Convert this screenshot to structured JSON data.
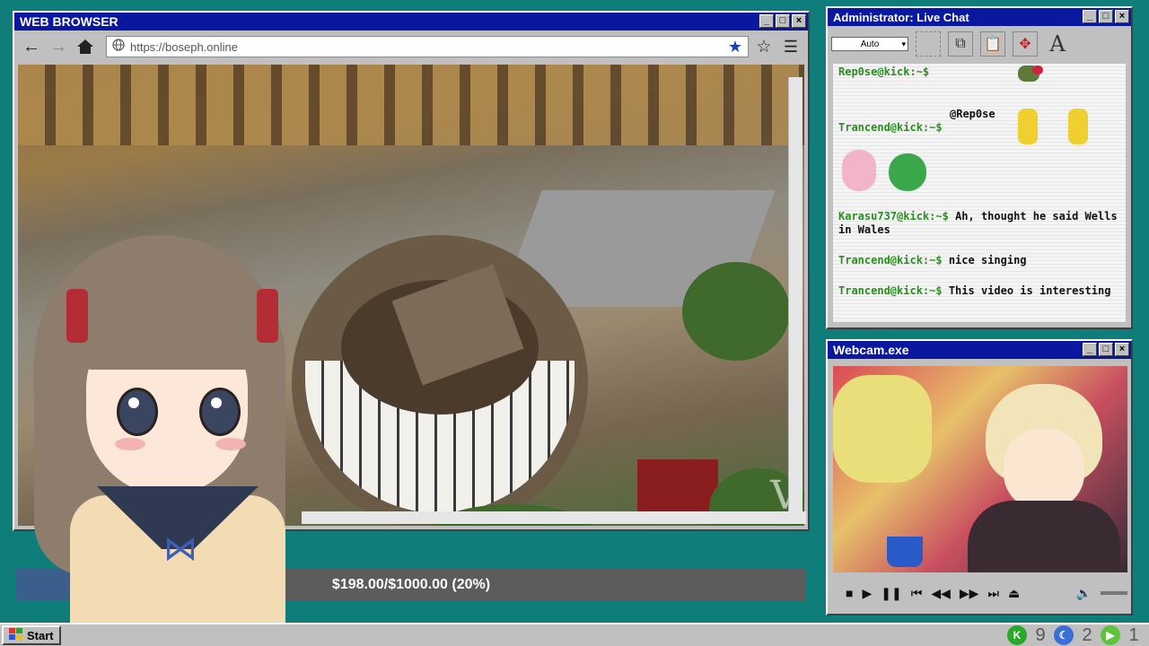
{
  "browser": {
    "title": "WEB BROWSER",
    "url": "https://boseph.online",
    "watermark": "V"
  },
  "progress": {
    "text": "$198.00/$1000.00 (20%)",
    "fraction": 0.2
  },
  "chat": {
    "title": "Administrator: Live Chat",
    "zoom_select": "Auto",
    "messages": [
      {
        "who": "Rep0se@kick:~$",
        "text": ""
      },
      {
        "who": "",
        "text": "@Rep0se"
      },
      {
        "who": "Trancend@kick:~$",
        "text": ""
      },
      {
        "who": "Karasu737@kick:~$",
        "text": "Ah, thought he said Wells in Wales"
      },
      {
        "who": "Trancend@kick:~$",
        "text": "nice singing"
      },
      {
        "who": "Trancend@kick:~$",
        "text": "This video is interesting"
      }
    ]
  },
  "webcam": {
    "title": "Webcam.exe"
  },
  "taskbar": {
    "start_label": "Start",
    "tray": [
      "9",
      "2",
      "1"
    ]
  },
  "colors": {
    "desktop": "#0f7d7a",
    "titlebar": "#0a18a0",
    "chat_user": "#2a8f1f"
  }
}
